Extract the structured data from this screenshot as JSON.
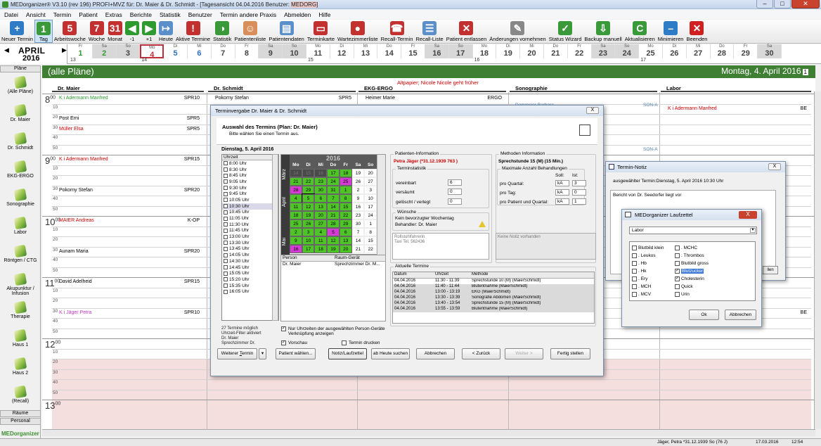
{
  "window": {
    "title_prefix": "MEDorganizer® V3.10 (rev 196) PROFI+MVZ für: Dr. Maier & Dr. Schmidt - [Tagesansicht 04.04.2016     Benutzer: ",
    "title_user": "MEDORG]"
  },
  "menu": [
    "Datei",
    "Ansicht",
    "Termin",
    "Patient",
    "Extras",
    "Berichte",
    "Statistik",
    "Benutzer",
    "Termin andere Praxis",
    "Abmelden",
    "Hilfe"
  ],
  "toolbar": [
    {
      "label": "Neuer Termin",
      "icon": "new-appointment-icon",
      "color": "#2e7bc6",
      "glyph": "+"
    },
    {
      "label": "Tag",
      "icon": "day-view-icon",
      "color": "#3a9a3a",
      "glyph": "1",
      "active": true
    },
    {
      "label": "Arbeitswoche",
      "icon": "workweek-view-icon",
      "color": "#c23030",
      "glyph": "5"
    },
    {
      "label": "Woche",
      "icon": "week-view-icon",
      "color": "#c23030",
      "glyph": "7"
    },
    {
      "label": "Monat",
      "icon": "month-view-icon",
      "color": "#c23030",
      "glyph": "31"
    },
    {
      "label": "-1",
      "icon": "prev-day-icon",
      "color": "#2f9a2f",
      "glyph": "◀"
    },
    {
      "label": "+1",
      "icon": "next-day-icon",
      "color": "#2f9a2f",
      "glyph": "▶"
    },
    {
      "label": "Heute",
      "icon": "today-icon",
      "color": "#5b8fc9",
      "glyph": "↦"
    },
    {
      "label": "Aktive Termine",
      "icon": "active-appointments-icon",
      "color": "#c23030",
      "glyph": "!"
    },
    {
      "label": "Statistik",
      "icon": "statistics-icon",
      "color": "#3a9a3a",
      "glyph": "◑"
    },
    {
      "label": "Patientenliste",
      "icon": "patient-list-icon",
      "color": "#d98f5a",
      "glyph": "☺"
    },
    {
      "label": "Patientendaten",
      "icon": "patient-data-icon",
      "color": "#5b8fc9",
      "glyph": "▤"
    },
    {
      "label": "Terminkarte",
      "icon": "appointment-card-icon",
      "color": "#c23030",
      "glyph": "▭"
    },
    {
      "label": "Wartezimmerliste",
      "icon": "waiting-room-icon",
      "color": "#c23030",
      "glyph": "●"
    },
    {
      "label": "Recall-Termin",
      "icon": "recall-appointment-icon",
      "color": "#c23030",
      "glyph": "☎"
    },
    {
      "label": "Recall-Liste",
      "icon": "recall-list-icon",
      "color": "#5b8fc9",
      "glyph": "☰"
    },
    {
      "label": "Patient entlassen",
      "icon": "discharge-patient-icon",
      "color": "#c23030",
      "glyph": "✕"
    },
    {
      "label": "Änderungen vornehmen",
      "icon": "edit-changes-icon",
      "color": "#888888",
      "glyph": "✎"
    },
    {
      "label": "Status Wizard",
      "icon": "status-wizard-icon",
      "color": "#3a9a3a",
      "glyph": "✓"
    },
    {
      "label": "Backup manuell",
      "icon": "backup-icon",
      "color": "#3a9a3a",
      "glyph": "⇩"
    },
    {
      "label": "Aktualisieren",
      "icon": "refresh-icon",
      "color": "#3a9a3a",
      "glyph": "C"
    },
    {
      "label": "Minimieren",
      "icon": "minimize-icon",
      "color": "#2e7bc6",
      "glyph": "–"
    },
    {
      "label": "Beenden",
      "icon": "exit-icon",
      "color": "#d02020",
      "glyph": "✕"
    }
  ],
  "datestrip": {
    "month": "APRIL",
    "year": "2016",
    "days": [
      {
        "dn": "Fr",
        "dd": "1",
        "we": false,
        "sel": false,
        "color": "#2f9a2f"
      },
      {
        "dn": "Sa",
        "dd": "2",
        "we": true,
        "sel": false,
        "color": "#2f9a2f"
      },
      {
        "dn": "So",
        "dd": "3",
        "we": true,
        "sel": false,
        "color": "#444"
      },
      {
        "dn": "Mo",
        "dd": "4",
        "we": false,
        "sel": true,
        "color": "#c0303a"
      },
      {
        "dn": "Di",
        "dd": "5",
        "we": false,
        "sel": false,
        "color": "#2f6fc0"
      },
      {
        "dn": "Mi",
        "dd": "6",
        "we": false,
        "sel": false,
        "color": "#2f6fc0"
      },
      {
        "dn": "Do",
        "dd": "7",
        "we": false,
        "sel": false,
        "color": "#444"
      },
      {
        "dn": "Fr",
        "dd": "8",
        "we": false,
        "sel": false,
        "color": "#444"
      },
      {
        "dn": "Sa",
        "dd": "9",
        "we": true,
        "sel": false,
        "color": "#444"
      },
      {
        "dn": "So",
        "dd": "10",
        "we": true,
        "sel": false,
        "color": "#444"
      },
      {
        "dn": "Mo",
        "dd": "11",
        "we": false,
        "sel": false,
        "color": "#444"
      },
      {
        "dn": "Di",
        "dd": "12",
        "we": false,
        "sel": false,
        "color": "#444"
      },
      {
        "dn": "Mi",
        "dd": "13",
        "we": false,
        "sel": false,
        "color": "#444"
      },
      {
        "dn": "Do",
        "dd": "14",
        "we": false,
        "sel": false,
        "color": "#444"
      },
      {
        "dn": "Fr",
        "dd": "15",
        "we": false,
        "sel": false,
        "color": "#444"
      },
      {
        "dn": "Sa",
        "dd": "16",
        "we": true,
        "sel": false,
        "color": "#444"
      },
      {
        "dn": "So",
        "dd": "17",
        "we": true,
        "sel": false,
        "color": "#444"
      },
      {
        "dn": "Mo",
        "dd": "18",
        "we": false,
        "sel": false,
        "color": "#444"
      },
      {
        "dn": "Di",
        "dd": "19",
        "we": false,
        "sel": false,
        "color": "#444"
      },
      {
        "dn": "Mi",
        "dd": "20",
        "we": false,
        "sel": false,
        "color": "#444"
      },
      {
        "dn": "Do",
        "dd": "21",
        "we": false,
        "sel": false,
        "color": "#444"
      },
      {
        "dn": "Fr",
        "dd": "22",
        "we": false,
        "sel": false,
        "color": "#444"
      },
      {
        "dn": "Sa",
        "dd": "23",
        "we": true,
        "sel": false,
        "color": "#444"
      },
      {
        "dn": "So",
        "dd": "24",
        "we": true,
        "sel": false,
        "color": "#444"
      },
      {
        "dn": "Mo",
        "dd": "25",
        "we": false,
        "sel": false,
        "color": "#444"
      },
      {
        "dn": "Di",
        "dd": "26",
        "we": false,
        "sel": false,
        "color": "#444"
      },
      {
        "dn": "Mi",
        "dd": "27",
        "we": false,
        "sel": false,
        "color": "#444"
      },
      {
        "dn": "Do",
        "dd": "28",
        "we": false,
        "sel": false,
        "color": "#444"
      },
      {
        "dn": "Fr",
        "dd": "29",
        "we": false,
        "sel": false,
        "color": "#444"
      },
      {
        "dn": "Sa",
        "dd": "30",
        "we": true,
        "sel": false,
        "color": "#444"
      }
    ],
    "weeks": [
      "13",
      "14",
      "15",
      "16",
      "17"
    ]
  },
  "sidebar": {
    "header": "Pläne",
    "items": [
      "(Alle Pläne)",
      "Dr. Maier",
      "Dr. Schmidt",
      "EKG-ERGO",
      "Sonographie",
      "Labor",
      "Röntgen / CTG",
      "Akupunktur / Infusion",
      "Therapie",
      "Haus 1",
      "Haus 2",
      "(Recall)"
    ],
    "footer_rooms": "Räume",
    "footer_staff": "Personal",
    "brand": "MEDorganizer"
  },
  "calendar": {
    "plan_title": "(alle Pläne)",
    "date_title": "Montag, 4. April 2016",
    "date_badge": "1",
    "alert": "Altpapier; Nicole Nicole geht früher",
    "columns": [
      "Dr. Maier",
      "Dr. Schmidt",
      "EKG-ERGO",
      "Sonographie",
      "Labor"
    ],
    "hours": [
      "8",
      "9",
      "10",
      "11",
      "12",
      "13"
    ],
    "minutes": [
      "10",
      "20",
      "30",
      "40",
      "50"
    ],
    "appointments": [
      {
        "col": 0,
        "row": 0,
        "text": "K i Adermann Manfred",
        "room": "SPR10",
        "color": "#2f9a2f"
      },
      {
        "col": 0,
        "row": 2,
        "text": "Post Erni",
        "room": "SPR5",
        "color": "#000"
      },
      {
        "col": 0,
        "row": 3,
        "text": "Müller Elsa",
        "room": "SPR5",
        "color": "#c00"
      },
      {
        "col": 0,
        "row": 6,
        "text": "K i Adermann Manfred",
        "room": "SPR15",
        "color": "#c00"
      },
      {
        "col": 0,
        "row": 9,
        "text": "Pokorny Stefan",
        "room": "SPR20",
        "color": "#000"
      },
      {
        "col": 0,
        "row": 12,
        "text": "MAIER Andreas",
        "room": "K-OP",
        "color": "#c00"
      },
      {
        "col": 0,
        "row": 15,
        "text": "Aunam Maria",
        "room": "SPR20",
        "color": "#000"
      },
      {
        "col": 0,
        "row": 18,
        "text": "David Adelheid",
        "room": "SPR15",
        "color": "#000"
      },
      {
        "col": 0,
        "row": 21,
        "text": "K i Jäger Petra",
        "room": "SPR10",
        "color": "#c03ac0"
      },
      {
        "col": 1,
        "row": 0,
        "text": "Pokorny Stefan",
        "room": "SPR5",
        "color": "#000"
      },
      {
        "col": 2,
        "row": 0,
        "text": "Heimer Marie",
        "room": "ERGO",
        "color": "#000"
      },
      {
        "col": 4,
        "row": 1,
        "text": "K i Adermann Manfred",
        "room": "BE",
        "color": "#c00"
      },
      {
        "col": 4,
        "row": 21,
        "text": "K i Jäger Petra",
        "room": "BE",
        "color": "#c03ac0"
      }
    ],
    "sono_labels": [
      "Dammeier Barbara",
      "SON-A",
      "SON-A"
    ]
  },
  "dialog": {
    "title": "Terminvergabe Dr. Maier & Dr. Schmidt",
    "close": "X",
    "head_title": "Auswahl des Termins (Plan: Dr. Maier)",
    "head_sub": "Bitte wählen Sie einen Termin aus.",
    "date": "Dienstag, 5. April 2016",
    "slot_header": "Uhrzeit",
    "slots": [
      "8:00 Uhr",
      "8:30 Uhr",
      "8:45 Uhr",
      "9:05 Uhr",
      "9:30 Uhr",
      "9:45 Uhr",
      "10:05 Uhr",
      "10:30 Uhr",
      "10:45 Uhr",
      "11:05 Uhr",
      "11:30 Uhr",
      "11:45 Uhr",
      "13:00 Uhr",
      "13:30 Uhr",
      "13:45 Uhr",
      "14:05 Uhr",
      "14:30 Uhr",
      "14:45 Uhr",
      "15:05 Uhr",
      "15:20 Uhr",
      "15:35 Uhr",
      "16:05 Uhr"
    ],
    "selected_slot": 7,
    "minical": {
      "year": "2016",
      "weekdays": [
        "Mo",
        "Di",
        "Mi",
        "Do",
        "Fr",
        "Sa",
        "So"
      ],
      "months": [
        "März",
        "April",
        "Mai"
      ],
      "rows": [
        [
          [
            "14",
            "d"
          ],
          [
            "15",
            "d"
          ],
          [
            "16",
            "d"
          ],
          [
            "17",
            "g"
          ],
          [
            "18",
            "g"
          ],
          [
            "19",
            "w"
          ],
          [
            "20",
            "w"
          ]
        ],
        [
          [
            "21",
            "g"
          ],
          [
            "22",
            "g"
          ],
          [
            "23",
            "g"
          ],
          [
            "24",
            "g"
          ],
          [
            "25",
            "m"
          ],
          [
            "26",
            "w"
          ],
          [
            "27",
            "w"
          ]
        ],
        [
          [
            "28",
            "m"
          ],
          [
            "29",
            "g"
          ],
          [
            "30",
            "g"
          ],
          [
            "31",
            "g"
          ],
          [
            "1",
            "g"
          ],
          [
            "2",
            "w"
          ],
          [
            "3",
            "w"
          ]
        ],
        [
          [
            "4",
            "g"
          ],
          [
            "5",
            "g"
          ],
          [
            "6",
            "g"
          ],
          [
            "7",
            "g"
          ],
          [
            "8",
            "g"
          ],
          [
            "9",
            "w"
          ],
          [
            "10",
            "w"
          ]
        ],
        [
          [
            "11",
            "g"
          ],
          [
            "12",
            "g"
          ],
          [
            "13",
            "g"
          ],
          [
            "14",
            "g"
          ],
          [
            "15",
            "g"
          ],
          [
            "16",
            "w"
          ],
          [
            "17",
            "w"
          ]
        ],
        [
          [
            "18",
            "g"
          ],
          [
            "19",
            "g"
          ],
          [
            "20",
            "g"
          ],
          [
            "21",
            "g"
          ],
          [
            "22",
            "g"
          ],
          [
            "23",
            "w"
          ],
          [
            "24",
            "w"
          ]
        ],
        [
          [
            "25",
            "g"
          ],
          [
            "26",
            "g"
          ],
          [
            "27",
            "g"
          ],
          [
            "28",
            "g"
          ],
          [
            "29",
            "g"
          ],
          [
            "30",
            "w"
          ],
          [
            "1",
            "w"
          ]
        ],
        [
          [
            "2",
            "g"
          ],
          [
            "3",
            "g"
          ],
          [
            "4",
            "g"
          ],
          [
            "5",
            "m"
          ],
          [
            "6",
            "g"
          ],
          [
            "7",
            "w"
          ],
          [
            "8",
            "w"
          ]
        ],
        [
          [
            "9",
            "g"
          ],
          [
            "10",
            "g"
          ],
          [
            "11",
            "g"
          ],
          [
            "12",
            "g"
          ],
          [
            "13",
            "g"
          ],
          [
            "14",
            "w"
          ],
          [
            "15",
            "w"
          ]
        ],
        [
          [
            "16",
            "m"
          ],
          [
            "17",
            "g"
          ],
          [
            "18",
            "g"
          ],
          [
            "19",
            "g"
          ],
          [
            "20",
            "g"
          ],
          [
            "21",
            "w"
          ],
          [
            "22",
            "w"
          ]
        ]
      ]
    },
    "person_headers": [
      "Person",
      "Raum-Gerät"
    ],
    "person_row": [
      "Dr. Maier",
      "Sprechzimmer Dr. M..."
    ],
    "bottom_info": [
      "27 Termine möglich",
      "Uhrzeit-Filter aktiviert",
      "Dr. Maier",
      "Sprechzimmer Dr."
    ],
    "chk_only_times": "Nur Uhrzeiten der ausgewählten Person-Geräte Verknüpfung anzeigen",
    "chk_preview": "Vorschau",
    "chk_print": "Termin drucken",
    "patient": {
      "group": "Patienten-Information",
      "name": "Petra Jäger (*31.12.1939 763 )",
      "stat_group": "Terminstatistik",
      "agreed_label": "vereinbart",
      "agreed_val": "6",
      "missed_label": "versäumt",
      "missed_val": "0",
      "deleted_label": "gelöscht / verlegt",
      "deleted_val": "0",
      "wishes_group": "Wünsche",
      "wish1": "Kein bevorzugter Wochentag",
      "wish2": "Behandler: Dr. Maier",
      "notes": "Rollstuhlfahrerin\nTaxi Tel. 562436"
    },
    "method": {
      "group": "Methoden Information",
      "name": "Sprechstunde 15 (M) (15 Min.)",
      "sub": "Maximale Anzahl Behandlungen",
      "soll": "Soll:",
      "ist": "Ist:",
      "rows": [
        {
          "label": "pro Quartal:",
          "soll": "kA",
          "ist": "3"
        },
        {
          "label": "pro Tag:",
          "soll": "kA",
          "ist": "0"
        },
        {
          "label": "pro Patient und Quartal:",
          "soll": "kA",
          "ist": "1"
        }
      ],
      "note": "Keine Notiz vorhanden"
    },
    "current": {
      "group": "Aktuelle Termine",
      "headers": [
        "Datum",
        "Uhrzeit",
        "Methode"
      ],
      "rows": [
        [
          "04.04.2016",
          "11:30 - 11:39",
          "Sprechstunde 10 (M) (MaierSchmidt)"
        ],
        [
          "04.04.2016",
          "11:40 - 11:44",
          "Blutentnahme (MaierSchmidt)"
        ],
        [
          "04.04.2016",
          "13:00 - 13:19",
          "EKG (MaierSchmidt)"
        ],
        [
          "04.04.2016",
          "13:30 - 13:39",
          "Sonografie Abdomen (MaierSchmidt)"
        ],
        [
          "04.04.2016",
          "13:40 - 13:54",
          "Sprechstunde 15 (M) (MaierSchmidt)"
        ],
        [
          "04.04.2016",
          "13:55 - 13:59",
          "Blutentnahme (MaierSchmidt)"
        ]
      ]
    },
    "buttons": {
      "next_term_pre": "Weiterer ",
      "next_term_u": "T",
      "next_term_post": "ermin",
      "patient_choose": "Patient wählen...",
      "note": "Notiz/Laufzettel",
      "from_today": "ab Heute suchen",
      "cancel": "Abbrechen",
      "back": "< Zurück",
      "next": "Weiter >",
      "finish": "Fertig stellen"
    }
  },
  "notiz": {
    "title": "Termin-Notiz",
    "close": "X",
    "selected": "ausgewählter Termin:Dienstag, 5. April 2016 10:30 Uhr",
    "text": "Bericht von Dr. Seedorfer liegt vor",
    "side_btn": "llen"
  },
  "laufzettel": {
    "title": "MEDorganizer Laufzettel",
    "close": "X",
    "dept": "Labor",
    "col1": [
      {
        "label": "Blutbild klein",
        "checked": false,
        "hl": false
      },
      {
        "label": ". Leukos",
        "checked": false,
        "hl": false
      },
      {
        "label": ". Hb",
        "checked": false,
        "hl": false
      },
      {
        "label": ". Hk",
        "checked": false,
        "hl": false
      },
      {
        "label": ". Ery",
        "checked": false,
        "hl": false
      },
      {
        "label": ". MCH",
        "checked": false,
        "hl": false
      },
      {
        "label": ". MCV",
        "checked": false,
        "hl": false
      }
    ],
    "col2": [
      {
        "label": ". MCHC",
        "checked": false,
        "hl": false
      },
      {
        "label": ". Thrombos",
        "checked": false,
        "hl": false
      },
      {
        "label": "Blutbild gross",
        "checked": false,
        "hl": false
      },
      {
        "label": "Blutzucker",
        "checked": true,
        "hl": true
      },
      {
        "label": "Cholesterin",
        "checked": true,
        "hl": false
      },
      {
        "label": "Quick",
        "checked": false,
        "hl": false
      },
      {
        "label": "Urin",
        "checked": false,
        "hl": false
      }
    ],
    "ok": "Ok",
    "cancel": "Abbrechen"
  },
  "status": {
    "patient": "Jäger, Petra *31.12.1939 So (76 J)",
    "date": "17.03.2016",
    "time": "12:54"
  }
}
